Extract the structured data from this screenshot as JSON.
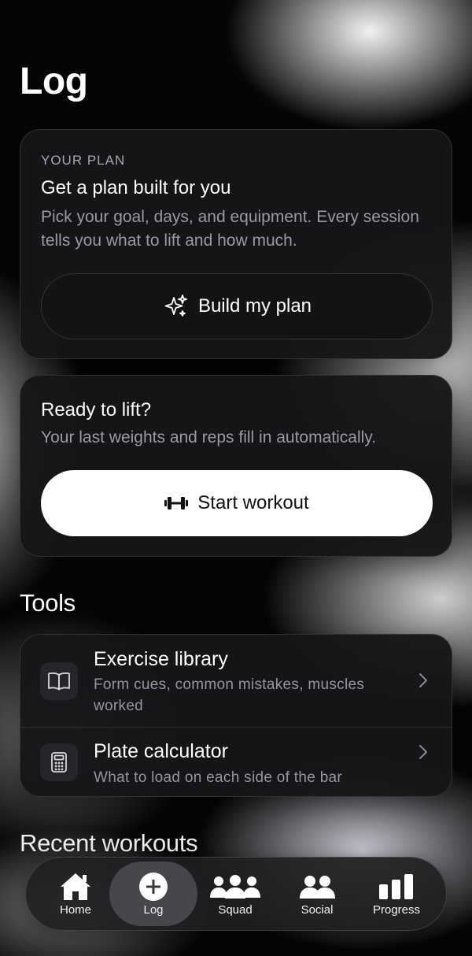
{
  "page": {
    "title": "Log"
  },
  "plan_card": {
    "eyebrow": "YOUR PLAN",
    "title": "Get a plan built for you",
    "description": "Pick your goal, days, and equipment. Every session tells you what to lift and how much.",
    "button_label": "Build my plan",
    "button_icon": "sparkles-icon"
  },
  "ready_card": {
    "title": "Ready to lift?",
    "description": "Your last weights and reps fill in automatically.",
    "button_label": "Start workout",
    "button_icon": "dumbbell-icon"
  },
  "tools": {
    "section_title": "Tools",
    "items": [
      {
        "title": "Exercise library",
        "subtitle": "Form cues, common mistakes, muscles worked",
        "icon": "book-icon"
      },
      {
        "title": "Plate calculator",
        "subtitle": "What to load on each side of the bar",
        "icon": "calculator-icon"
      }
    ]
  },
  "recent": {
    "section_title": "Recent workouts"
  },
  "tabbar": {
    "active": "Log",
    "items": [
      {
        "label": "Home",
        "icon": "home-icon"
      },
      {
        "label": "Log",
        "icon": "plus-circle-icon"
      },
      {
        "label": "Squad",
        "icon": "group-icon"
      },
      {
        "label": "Social",
        "icon": "people-icon"
      },
      {
        "label": "Progress",
        "icon": "bar-chart-icon"
      }
    ]
  },
  "colors": {
    "card_bg": "#161618",
    "muted_text": "#9a9aa0",
    "primary_button_bg": "#ffffff"
  }
}
